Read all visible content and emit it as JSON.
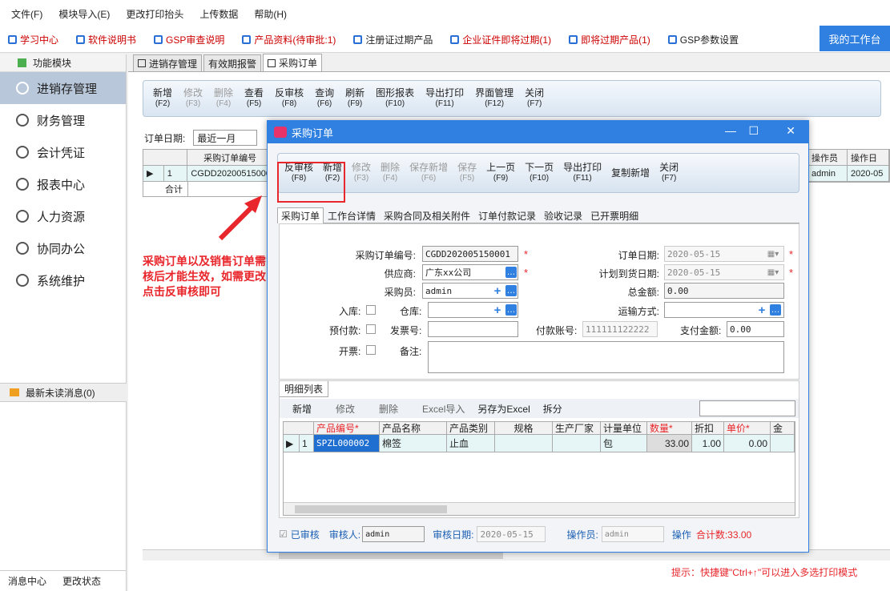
{
  "menu": [
    "文件(F)",
    "模块导入(E)",
    "更改打印抬头",
    "上传数据",
    "帮助(H)"
  ],
  "quick": [
    "学习中心",
    "软件说明书",
    "GSP审查说明",
    "产品资料(待审批:1)",
    "注册证过期产品",
    "企业证件即将过期(1)",
    "即将过期产品(1)",
    "GSP参数设置"
  ],
  "workbench": "我的工作台",
  "sidebar": {
    "header": "功能模块",
    "items": [
      "进销存管理",
      "财务管理",
      "会计凭证",
      "报表中心",
      "人力资源",
      "协同办公",
      "系统维护"
    ],
    "msg": "最新未读消息(0)",
    "foot": [
      "消息中心",
      "更改状态"
    ]
  },
  "tabs": [
    "进销存管理",
    "有效期报警",
    "采购订单"
  ],
  "toolbar": [
    {
      "l": "新增",
      "k": "(F2)"
    },
    {
      "l": "修改",
      "k": "(F3)"
    },
    {
      "l": "删除",
      "k": "(F4)"
    },
    {
      "l": "查看",
      "k": "(F5)"
    },
    {
      "l": "反审核",
      "k": "(F8)"
    },
    {
      "l": "查询",
      "k": "(F6)"
    },
    {
      "l": "刷新",
      "k": "(F9)"
    },
    {
      "l": "图形报表",
      "k": "(F10)"
    },
    {
      "l": "导出打印",
      "k": "(F11)"
    },
    {
      "l": "界面管理",
      "k": "(F12)"
    },
    {
      "l": "关闭",
      "k": "(F7)"
    }
  ],
  "filter": {
    "label": "订单日期:",
    "value": "最近一月"
  },
  "list": {
    "h1": "采购订单编号",
    "rowno": "1",
    "code": "CGDD20200515000",
    "total": "合计",
    "h_op": "操作员",
    "h_date": "操作日",
    "op": "admin",
    "date": "2020-05"
  },
  "annotation": "采购订单以及销售订单需审核后才能生效，如需更改，点击反审核即可",
  "hint": "提示：快捷键\"Ctrl+↑\"可以进入多选打印模式",
  "dialog": {
    "title": "采购订单",
    "toolbar": [
      {
        "l": "反审核",
        "k": "(F8)"
      },
      {
        "l": "新增",
        "k": "(F2)"
      },
      {
        "l": "修改",
        "k": "(F3)"
      },
      {
        "l": "删除",
        "k": "(F4)"
      },
      {
        "l": "保存新增",
        "k": "(F6)"
      },
      {
        "l": "保存",
        "k": "(F5)"
      },
      {
        "l": "上一页",
        "k": "(F9)"
      },
      {
        "l": "下一页",
        "k": "(F10)"
      },
      {
        "l": "导出打印",
        "k": "(F11)"
      },
      {
        "l": "复制新增",
        "k": ""
      },
      {
        "l": "关闭",
        "k": "(F7)"
      }
    ],
    "tabs": [
      "采购订单",
      "工作台详情",
      "采购合同及相关附件",
      "订单付款记录",
      "验收记录",
      "已开票明细"
    ],
    "form": {
      "order_no_l": "采购订单编号:",
      "order_no": "CGDD202005150001",
      "supplier_l": "供应商:",
      "supplier": "广东xx公司",
      "buyer_l": "采购员:",
      "buyer": "admin",
      "instock_l": "入库:",
      "warehouse_l": "仓库:",
      "prepay_l": "预付款:",
      "invoice_no_l": "发票号:",
      "paycard_l": "付款账号:",
      "paycard": "111111122222",
      "paid_l": "支付金额:",
      "paid": "0.00",
      "invoice_l": "开票:",
      "note_l": "备注:",
      "order_date_l": "订单日期:",
      "order_date": "2020-05-15",
      "plan_date_l": "计划到货日期:",
      "plan_date": "2020-05-15",
      "total_l": "总金额:",
      "total": "0.00",
      "ship_l": "运输方式:"
    },
    "detail": {
      "tab": "明细列表",
      "tb": [
        "新增",
        "修改",
        "删除",
        "Excel导入",
        "另存为Excel",
        "拆分"
      ],
      "headers": [
        "产品编号*",
        "产品名称",
        "产品类别",
        "规格",
        "生产厂家",
        "计量单位",
        "数量*",
        "折扣",
        "单价*",
        "金"
      ],
      "row": {
        "no": "1",
        "code": "SPZL000002",
        "name": "棉签",
        "cat": "止血",
        "spec": "",
        "maker": "",
        "unit": "包",
        "qty": "33.00",
        "disc": "1.00",
        "price": "0.00"
      }
    },
    "footer": {
      "audited": "已审核",
      "auditor_l": "审核人:",
      "auditor": "admin",
      "adate_l": "审核日期:",
      "adate": "2020-05-15",
      "op_l": "操作员:",
      "op": "admin",
      "op2": "操作",
      "count": "合计数:33.00"
    }
  }
}
